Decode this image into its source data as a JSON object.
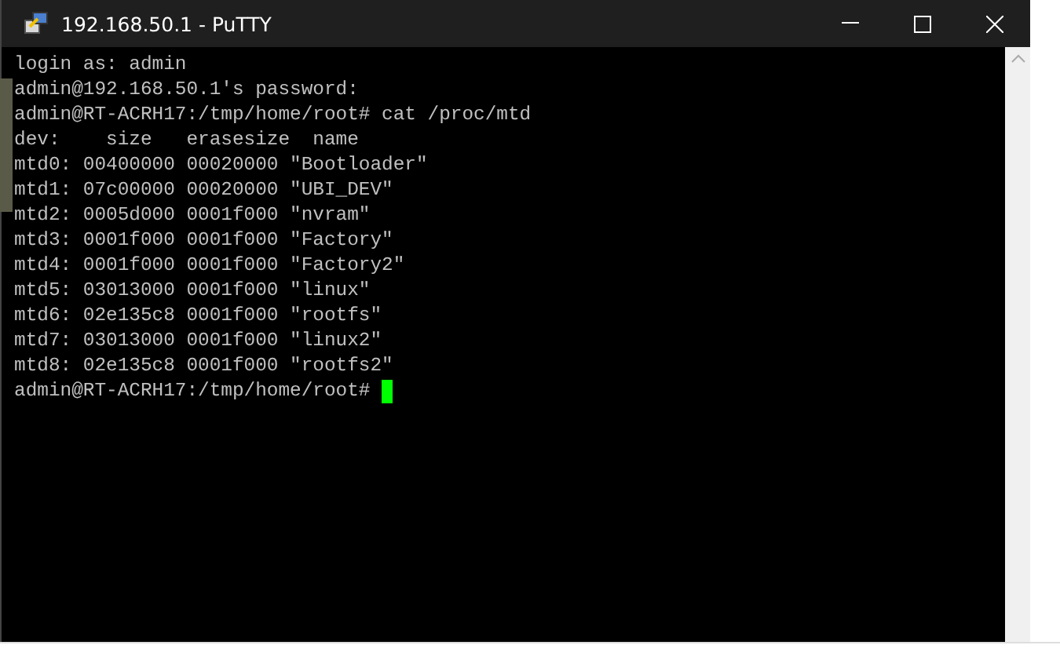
{
  "window": {
    "title": "192.168.50.1 - PuTTY"
  },
  "terminal": {
    "lines": [
      "login as: admin",
      "admin@192.168.50.1's password:",
      "admin@RT-ACRH17:/tmp/home/root# cat /proc/mtd",
      "dev:    size   erasesize  name",
      "mtd0: 00400000 00020000 \"Bootloader\"",
      "mtd1: 07c00000 00020000 \"UBI_DEV\"",
      "mtd2: 0005d000 0001f000 \"nvram\"",
      "mtd3: 0001f000 0001f000 \"Factory\"",
      "mtd4: 0001f000 0001f000 \"Factory2\"",
      "mtd5: 03013000 0001f000 \"linux\"",
      "mtd6: 02e135c8 0001f000 \"rootfs\"",
      "mtd7: 03013000 0001f000 \"linux2\"",
      "mtd8: 02e135c8 0001f000 \"rootfs2\""
    ],
    "prompt": "admin@RT-ACRH17:/tmp/home/root#"
  }
}
